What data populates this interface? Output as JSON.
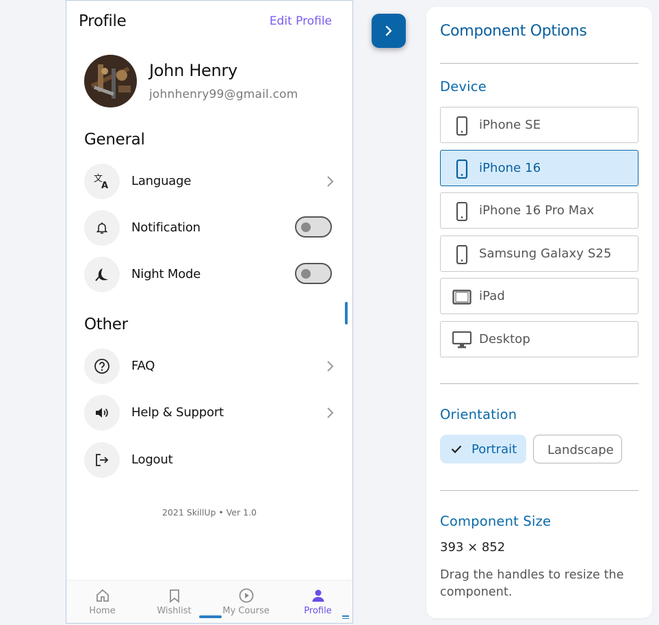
{
  "profile": {
    "title": "Profile",
    "edit_label": "Edit Profile",
    "user_name": "John Henry",
    "user_email": "johnhenry99@gmail.com"
  },
  "general": {
    "title": "General",
    "items": [
      {
        "label": "Language",
        "icon": "translate-icon",
        "control": "chevron"
      },
      {
        "label": "Notification",
        "icon": "bell-icon",
        "control": "toggle",
        "on": false
      },
      {
        "label": "Night Mode",
        "icon": "moon-icon",
        "control": "toggle",
        "on": false
      }
    ]
  },
  "other": {
    "title": "Other",
    "items": [
      {
        "label": "FAQ",
        "icon": "question-circle-icon",
        "control": "chevron"
      },
      {
        "label": "Help & Support",
        "icon": "speaker-icon",
        "control": "chevron"
      },
      {
        "label": "Logout",
        "icon": "logout-icon",
        "control": "none"
      }
    ]
  },
  "footer": "2021 SkillUp • Ver 1.0",
  "tabs": [
    {
      "label": "Home",
      "icon": "home-icon",
      "active": false
    },
    {
      "label": "Wishlist",
      "icon": "bookmark-icon",
      "active": false
    },
    {
      "label": "My Course",
      "icon": "play-circle-icon",
      "active": false
    },
    {
      "label": "Profile",
      "icon": "person-icon",
      "active": true
    }
  ],
  "options": {
    "title": "Component Options",
    "device_title": "Device",
    "devices": [
      {
        "label": "iPhone SE",
        "icon": "phone-icon"
      },
      {
        "label": "iPhone 16",
        "icon": "phone-icon",
        "selected": true
      },
      {
        "label": "iPhone 16 Pro Max",
        "icon": "phone-icon"
      },
      {
        "label": "Samsung Galaxy S25",
        "icon": "phone-icon"
      },
      {
        "label": "iPad",
        "icon": "tablet-icon"
      },
      {
        "label": "Desktop",
        "icon": "desktop-icon"
      }
    ],
    "orientation_title": "Orientation",
    "portrait_label": "Portrait",
    "landscape_label": "Landscape",
    "size_title": "Component Size",
    "size_value": "393 × 852",
    "size_hint": "Drag the handles to resize the component."
  },
  "colors": {
    "accent": "#0a65a8",
    "brand_purple": "#7a5cf0",
    "selected_bg": "#d5ebfb"
  }
}
